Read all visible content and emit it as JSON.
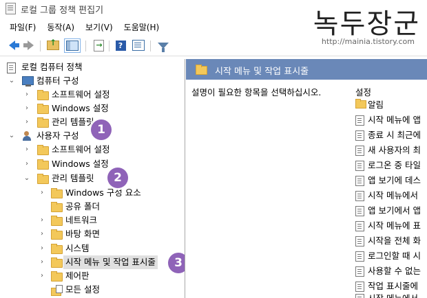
{
  "window": {
    "title": "로컬 그룹 정책 편집기"
  },
  "watermark": {
    "text": "녹두장군",
    "url": "http://mainia.tistory.com"
  },
  "menu": [
    "파일(F)",
    "동작(A)",
    "보기(V)",
    "도움말(H)"
  ],
  "toolbar": {
    "icons": [
      "back-arrow-icon",
      "forward-arrow-icon",
      "folder-up-icon",
      "show-hide-tree-icon",
      "export-list-icon",
      "help-icon",
      "properties-icon",
      "filter-icon"
    ]
  },
  "tree": {
    "root": "로컬 컴퓨터 정책",
    "computer_config": "컴퓨터 구성",
    "computer_software": "소프트웨어 설정",
    "computer_windows": "Windows 설정",
    "computer_admin": "관리 템플릿",
    "user_config": "사용자 구성",
    "user_software": "소프트웨어 설정",
    "user_windows": "Windows 설정",
    "user_admin": "관리 템플릿",
    "user_admin_children": [
      "Windows 구성 요소",
      "공유 폴더",
      "네트워크",
      "바탕 화면",
      "시스템",
      "시작 메뉴 및 작업 표시줄",
      "제어판",
      "모든 설정"
    ]
  },
  "badges": [
    "1",
    "2",
    "3"
  ],
  "right": {
    "header": "시작 메뉴 및 작업 표시줄",
    "description": "설명이 필요한 항목을 선택하십시오.",
    "column_header": "설정",
    "items": [
      "알림",
      "시작 메뉴에 앱",
      "종료 시 최근에",
      "새 사용자의 최",
      "로그온 중 타일",
      "앱 보기에 데스",
      "시작 메뉴에서",
      "앱 보기에서 앱",
      "시작 메뉴에 표",
      "시작을 전체 화",
      "로그인할 때 시",
      "사용할 수 없는",
      "작업 표시줄에",
      "시작 메뉴에서"
    ]
  }
}
